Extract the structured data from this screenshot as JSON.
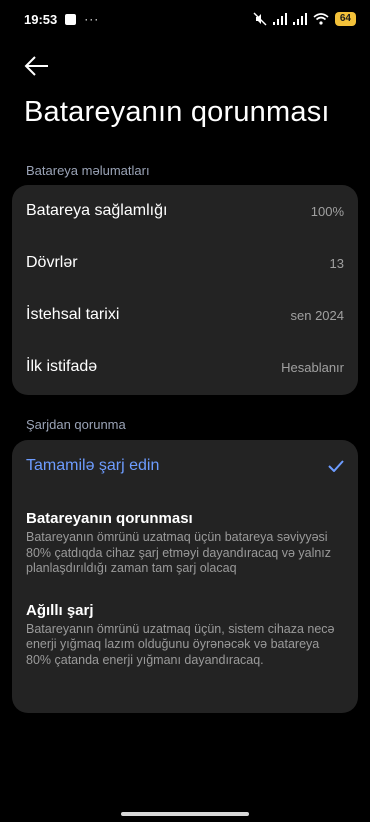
{
  "status_bar": {
    "time": "19:53",
    "more": "···",
    "battery_level": "64",
    "icons": [
      "notification-square-icon",
      "mute-icon",
      "signal-icon",
      "signal-icon",
      "wifi-icon",
      "battery-icon"
    ],
    "battery_color": "#f3c13a"
  },
  "header": {
    "back_icon": "arrow-left-icon",
    "title": "Batareyanın qorunması"
  },
  "battery_info": {
    "section_label": "Batareya məlumatları",
    "rows": [
      {
        "label": "Batareya sağlamlığı",
        "value": "100%"
      },
      {
        "label": "Dövrlər",
        "value": "13"
      },
      {
        "label": "İstehsal tarixi",
        "value": "sen 2024"
      },
      {
        "label": "İlk istifadə",
        "value": "Hesablanır"
      }
    ]
  },
  "charge_protection": {
    "section_label": "Şarjdan qorunma",
    "selected_color": "#6d9cff",
    "options": [
      {
        "title": "Tamamilə şarj edin",
        "description": "",
        "selected": true
      },
      {
        "title": "Batareyanın qorunması",
        "description": "Batareyanın ömrünü uzatmaq üçün batareya səviyyəsi 80% çatdıqda cihaz şarj etməyi dayandıracaq və yalnız planlaşdırıldığı zaman tam şarj olacaq",
        "selected": false
      },
      {
        "title": "Ağıllı şarj",
        "description": "Batareyanın ömrünü uzatmaq üçün, sistem cihaza necə enerji yığmaq lazım olduğunu öyrənəcək və batareya 80% çatanda enerji yığmanı dayandıracaq.",
        "selected": false
      }
    ]
  }
}
